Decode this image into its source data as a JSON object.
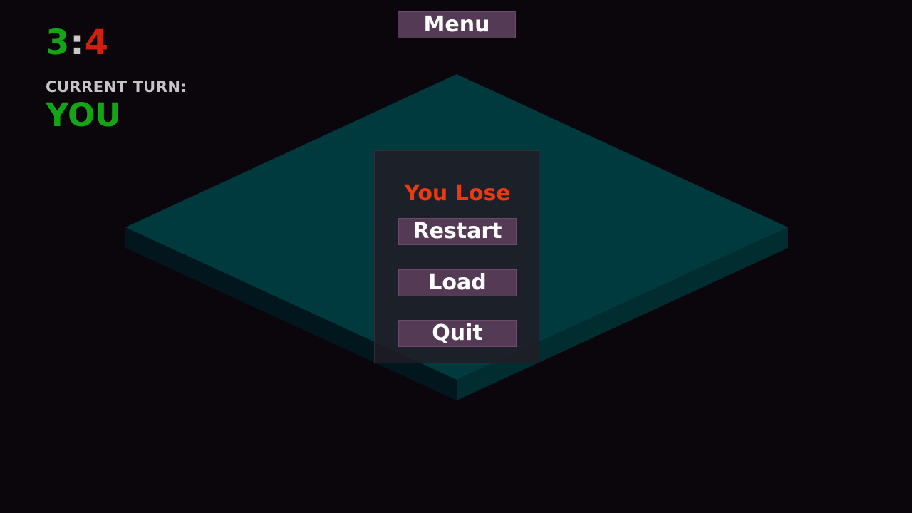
{
  "hud": {
    "score_player": "3",
    "score_separator": ":",
    "score_enemy": "4",
    "turn_label": "CURRENT TURN:",
    "turn_value": "YOU"
  },
  "menu": {
    "label": "Menu"
  },
  "dialog": {
    "result_text": "You Lose",
    "restart_label": "Restart",
    "load_label": "Load",
    "quit_label": "Quit"
  },
  "colors": {
    "background": "#0b060b",
    "board_top": "#003a3f",
    "player": "#14a514",
    "enemy": "#d0200e",
    "lose_text": "#ea3a12",
    "button": "#553a56"
  }
}
